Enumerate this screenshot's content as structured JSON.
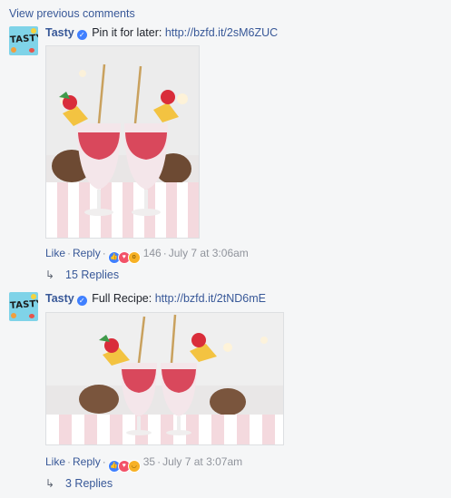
{
  "view_previous": "View previous comments",
  "comments": [
    {
      "author": "Tasty",
      "avatar_text": "TASTY",
      "text": "Pin it for later: ",
      "link": "http://bzfd.it/2sM6ZUC",
      "like": "Like",
      "reply": "Reply",
      "reaction_count": "146",
      "timestamp": "July 7 at 3:06am",
      "replies": "15 Replies",
      "reactions": [
        "like-icon",
        "love-icon",
        "wow-icon"
      ]
    },
    {
      "author": "Tasty",
      "avatar_text": "TASTY",
      "text": "Full Recipe: ",
      "link": "http://bzfd.it/2tND6mE",
      "like": "Like",
      "reply": "Reply",
      "reaction_count": "35",
      "timestamp": "July 7 at 3:07am",
      "replies": "3 Replies",
      "reactions": [
        "like-icon",
        "love-icon",
        "haha-icon"
      ]
    }
  ],
  "colors": {
    "link": "#385898",
    "meta": "#90949c",
    "background": "#f5f6f7",
    "like": "#4080ff",
    "love": "#f25268",
    "yellow": "#f7b125"
  }
}
